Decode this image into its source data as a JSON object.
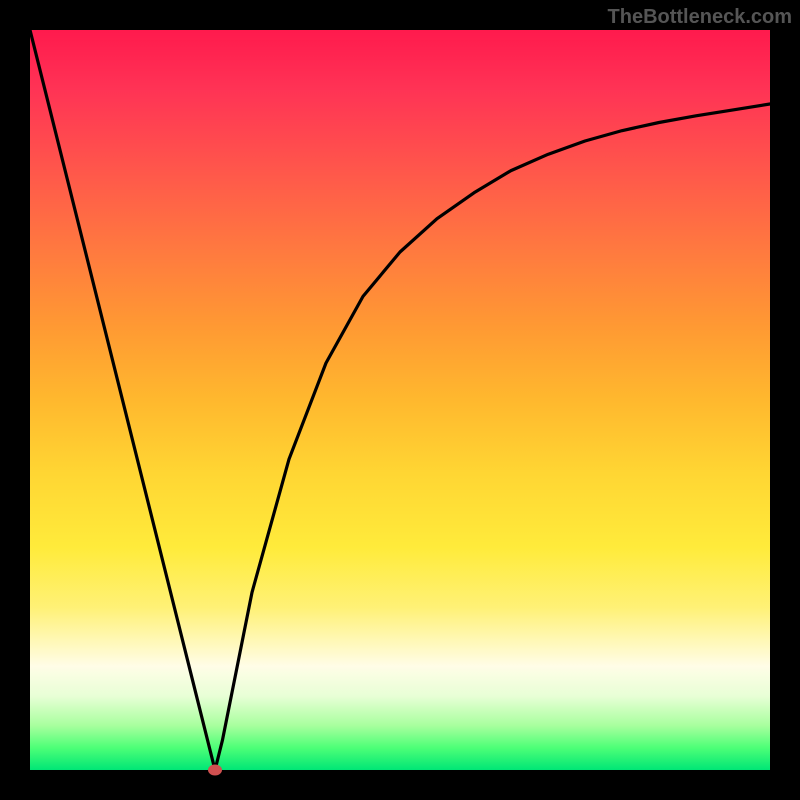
{
  "watermark": "TheBottleneck.com",
  "chart_data": {
    "type": "line",
    "title": "",
    "xlabel": "",
    "ylabel": "",
    "xlim": [
      0,
      100
    ],
    "ylim": [
      0,
      100
    ],
    "grid": false,
    "legend": false,
    "background_gradient": {
      "orientation": "vertical",
      "stops": [
        {
          "pos": 0.0,
          "color": "#ff1a4d"
        },
        {
          "pos": 0.5,
          "color": "#ffb82e"
        },
        {
          "pos": 0.75,
          "color": "#ffef5c"
        },
        {
          "pos": 1.0,
          "color": "#00e676"
        }
      ]
    },
    "series": [
      {
        "name": "bottleneck-curve",
        "x": [
          0,
          5,
          10,
          15,
          20,
          22,
          24,
          25,
          26,
          28,
          30,
          35,
          40,
          45,
          50,
          55,
          60,
          65,
          70,
          75,
          80,
          85,
          90,
          95,
          100
        ],
        "y": [
          100,
          80,
          60,
          40,
          20,
          12,
          4,
          0,
          4,
          14,
          24,
          42,
          55,
          64,
          70,
          74.5,
          78,
          81,
          83.2,
          85,
          86.4,
          87.5,
          88.4,
          89.2,
          90
        ]
      }
    ],
    "markers": [
      {
        "name": "optimal-point",
        "x": 25,
        "y": 0,
        "color": "#d05050"
      }
    ]
  }
}
